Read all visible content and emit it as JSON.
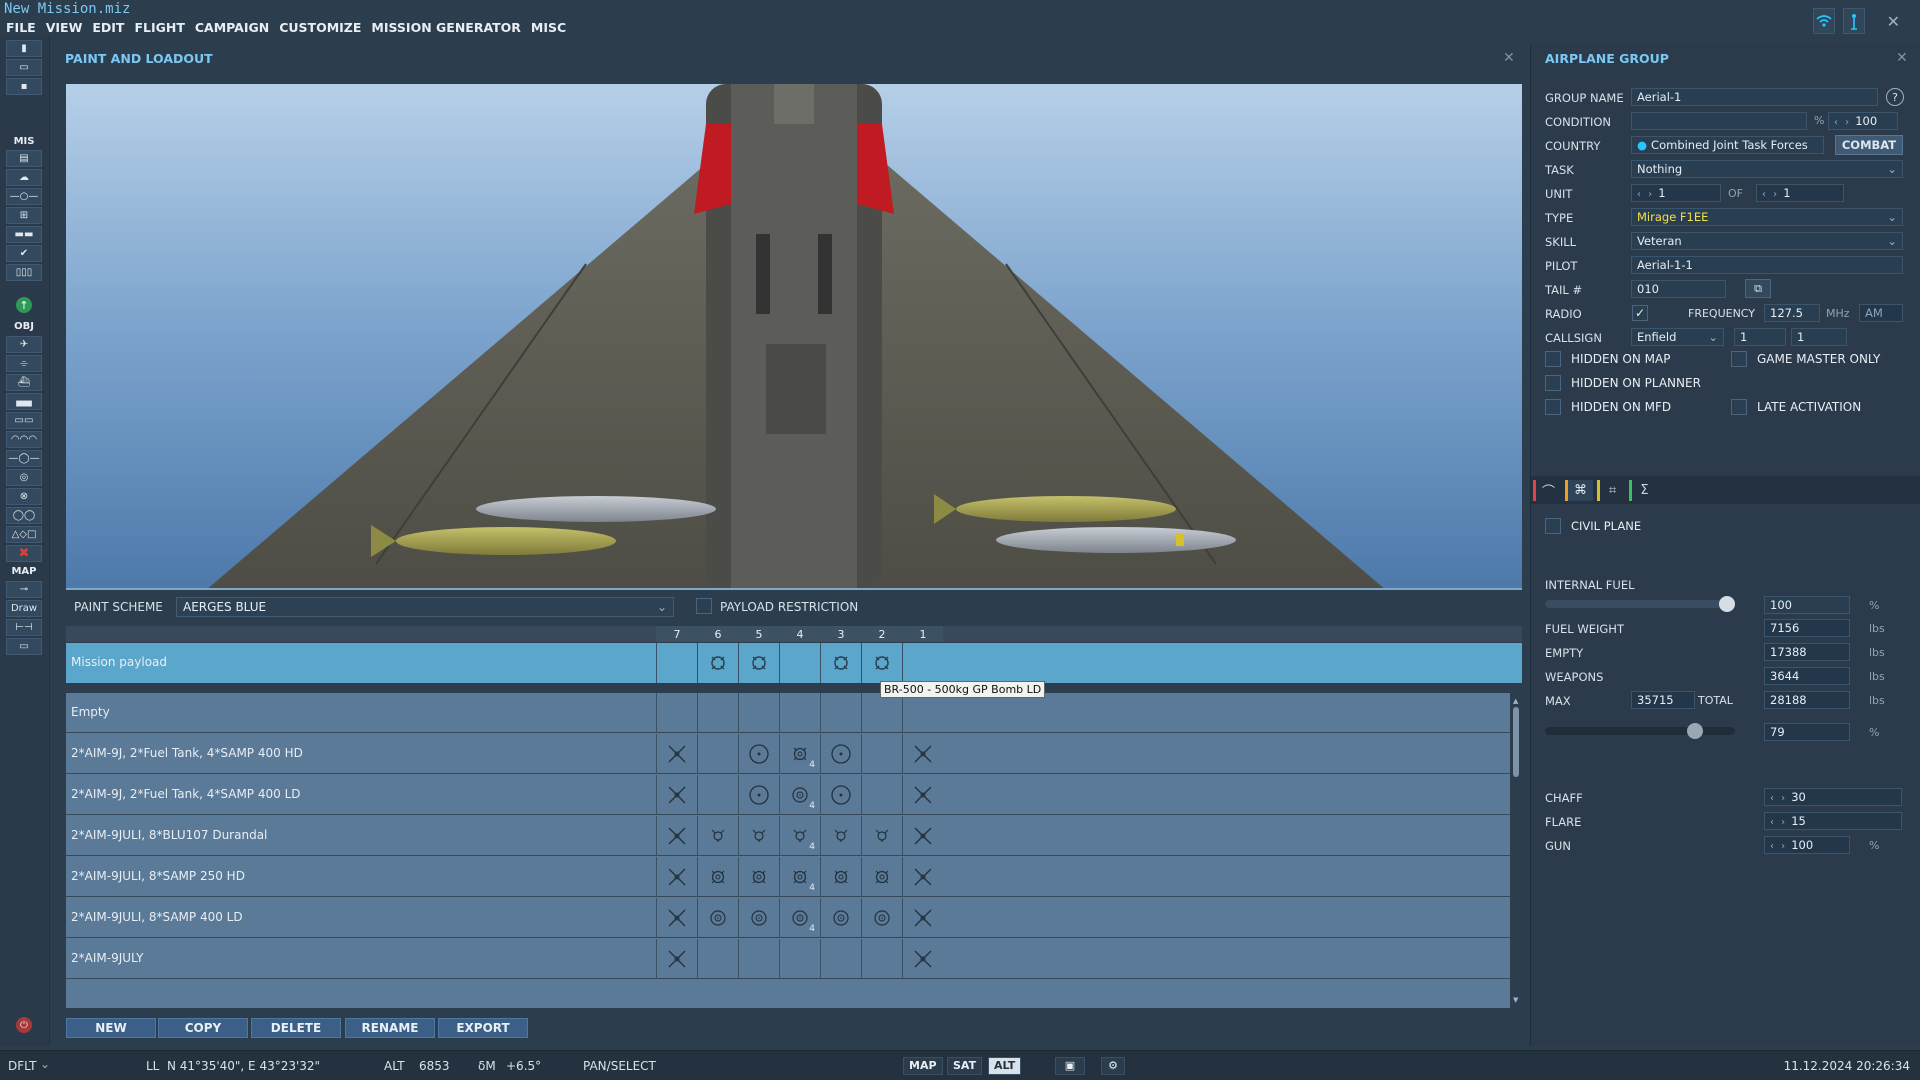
{
  "window": {
    "title": "New Mission.miz"
  },
  "menu": [
    "FILE",
    "VIEW",
    "EDIT",
    "FLIGHT",
    "CAMPAIGN",
    "CUSTOMIZE",
    "MISSION GENERATOR",
    "MISC"
  ],
  "toolbar_labels": {
    "mis": "MIS",
    "obj": "OBJ",
    "map": "MAP",
    "draw": "Draw"
  },
  "paint": {
    "title": "PAINT AND LOADOUT",
    "scheme_label": "PAINT SCHEME",
    "scheme_value": "AERGES BLUE",
    "payload_restriction_label": "PAYLOAD RESTRICTION",
    "stations": [
      "7",
      "6",
      "5",
      "4",
      "3",
      "2",
      "1"
    ],
    "tooltip": "BR-500 - 500kg GP Bomb LD",
    "mission_payload": "Mission payload",
    "rows": [
      {
        "name": "Empty"
      },
      {
        "name": "2*AIM-9J, 2*Fuel Tank, 4*SAMP 400 HD",
        "count": "4"
      },
      {
        "name": "2*AIM-9J, 2*Fuel Tank, 4*SAMP 400 LD",
        "count": "4"
      },
      {
        "name": "2*AIM-9JULI, 8*BLU107 Durandal",
        "count": "4"
      },
      {
        "name": "2*AIM-9JULI, 8*SAMP 250 HD",
        "count": "4"
      },
      {
        "name": "2*AIM-9JULI, 8*SAMP 400 LD",
        "count": "4"
      },
      {
        "name": "2*AIM-9JULY"
      }
    ],
    "buttons": [
      "NEW",
      "COPY",
      "DELETE",
      "RENAME",
      "EXPORT"
    ]
  },
  "group": {
    "title": "AIRPLANE GROUP",
    "group_name_label": "GROUP NAME",
    "group_name": "Aerial-1",
    "help_icon": "?",
    "condition_label": "CONDITION",
    "condition_unit": "%",
    "condition_value": "100",
    "country_label": "COUNTRY",
    "country_value": "Combined Joint Task Forces",
    "combat_button": "COMBAT",
    "task_label": "TASK",
    "task_value": "Nothing",
    "unit_label": "UNIT",
    "unit_value": "1",
    "of_label": "OF",
    "of_value": "1",
    "type_label": "TYPE",
    "type_value": "Mirage F1EE",
    "skill_label": "SKILL",
    "skill_value": "Veteran",
    "pilot_label": "PILOT",
    "pilot_value": "Aerial-1-1",
    "tail_label": "TAIL #",
    "tail_value": "010",
    "radio_label": "RADIO",
    "frequency_label": "FREQUENCY",
    "frequency_value": "127.5",
    "frequency_unit": "MHz",
    "modulation": "AM",
    "callsign_label": "CALLSIGN",
    "callsign_value": "Enfield",
    "callsign_n1": "1",
    "callsign_n2": "1",
    "hidden_map": "HIDDEN ON MAP",
    "game_master_only": "GAME MASTER ONLY",
    "hidden_planner": "HIDDEN ON PLANNER",
    "hidden_mfd": "HIDDEN ON MFD",
    "late_activation": "LATE ACTIVATION",
    "civil_plane": "CIVIL PLANE",
    "internal_fuel_label": "INTERNAL FUEL",
    "internal_fuel_value": "100",
    "internal_fuel_unit": "%",
    "internal_fuel_level": 1.0,
    "fuel_weight_label": "FUEL WEIGHT",
    "fuel_weight": "7156",
    "empty_label": "EMPTY",
    "empty": "17388",
    "weapons_label": "WEAPONS",
    "weapons": "3644",
    "max_label": "MAX",
    "max": "35715",
    "total_label": "TOTAL",
    "total": "28188",
    "lbs": "lbs",
    "total_pct": "79",
    "total_level": 0.79,
    "chaff_label": "CHAFF",
    "chaff": "30",
    "flare_label": "FLARE",
    "flare": "15",
    "gun_label": "GUN",
    "gun": "100"
  },
  "status": {
    "profile": "DFLT",
    "coords": "LL  N 41°35'40\", E 43°23'32\"",
    "alt_label": "ALT",
    "alt": "6853",
    "mag_label": "δM",
    "mag": "+6.5°",
    "mode": "PAN/SELECT",
    "map_btn": "MAP",
    "sat_btn": "SAT",
    "alt_btn": "ALT",
    "datetime": "11.12.2024 20:26:34"
  },
  "colors": {
    "accent": "#7cc8f2",
    "selected_row": "#5aa7cb",
    "wifi": "#25c7ff",
    "type_value": "#f0e04a"
  }
}
